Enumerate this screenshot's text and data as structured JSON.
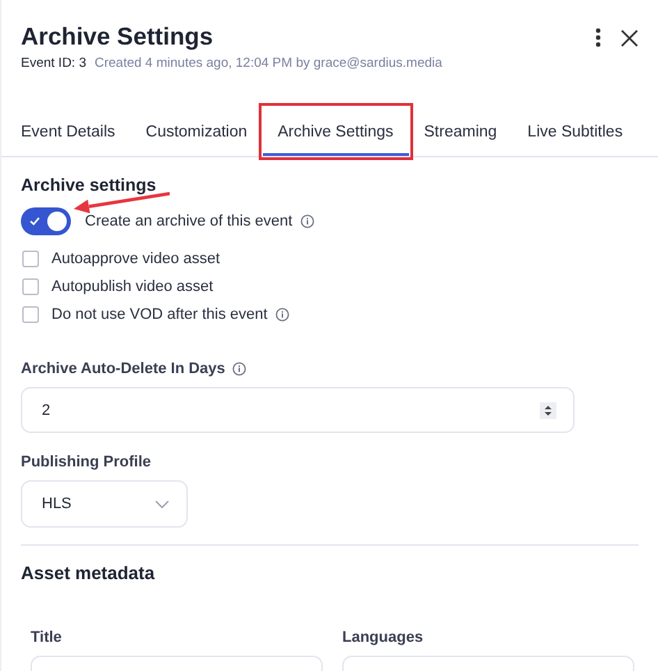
{
  "header": {
    "title": "Archive Settings",
    "event_id": "Event ID: 3",
    "created": "Created 4 minutes ago, 12:04 PM by grace@sardius.media"
  },
  "tabs": [
    {
      "label": "Event Details",
      "selected": false,
      "highlighted": false
    },
    {
      "label": "Customization",
      "selected": false,
      "highlighted": false
    },
    {
      "label": "Archive Settings",
      "selected": true,
      "highlighted": true
    },
    {
      "label": "Streaming",
      "selected": false,
      "highlighted": false
    },
    {
      "label": "Live Subtitles",
      "selected": false,
      "highlighted": false
    }
  ],
  "archive": {
    "heading": "Archive settings",
    "toggle": {
      "label": "Create an archive of this event",
      "on": true,
      "info": true,
      "pointed": true
    },
    "options": [
      {
        "label": "Autoapprove video asset",
        "checked": false,
        "info": false
      },
      {
        "label": "Autopublish video asset",
        "checked": false,
        "info": false
      },
      {
        "label": "Do not use VOD after this event",
        "checked": false,
        "info": true
      }
    ]
  },
  "auto_delete": {
    "label": "Archive Auto-Delete In Days",
    "info": true,
    "value": "2"
  },
  "publishing_profile": {
    "label": "Publishing Profile",
    "value": "HLS"
  },
  "asset_metadata": {
    "heading": "Asset metadata",
    "fields": [
      {
        "label": "Title"
      },
      {
        "label": "Languages"
      }
    ]
  }
}
